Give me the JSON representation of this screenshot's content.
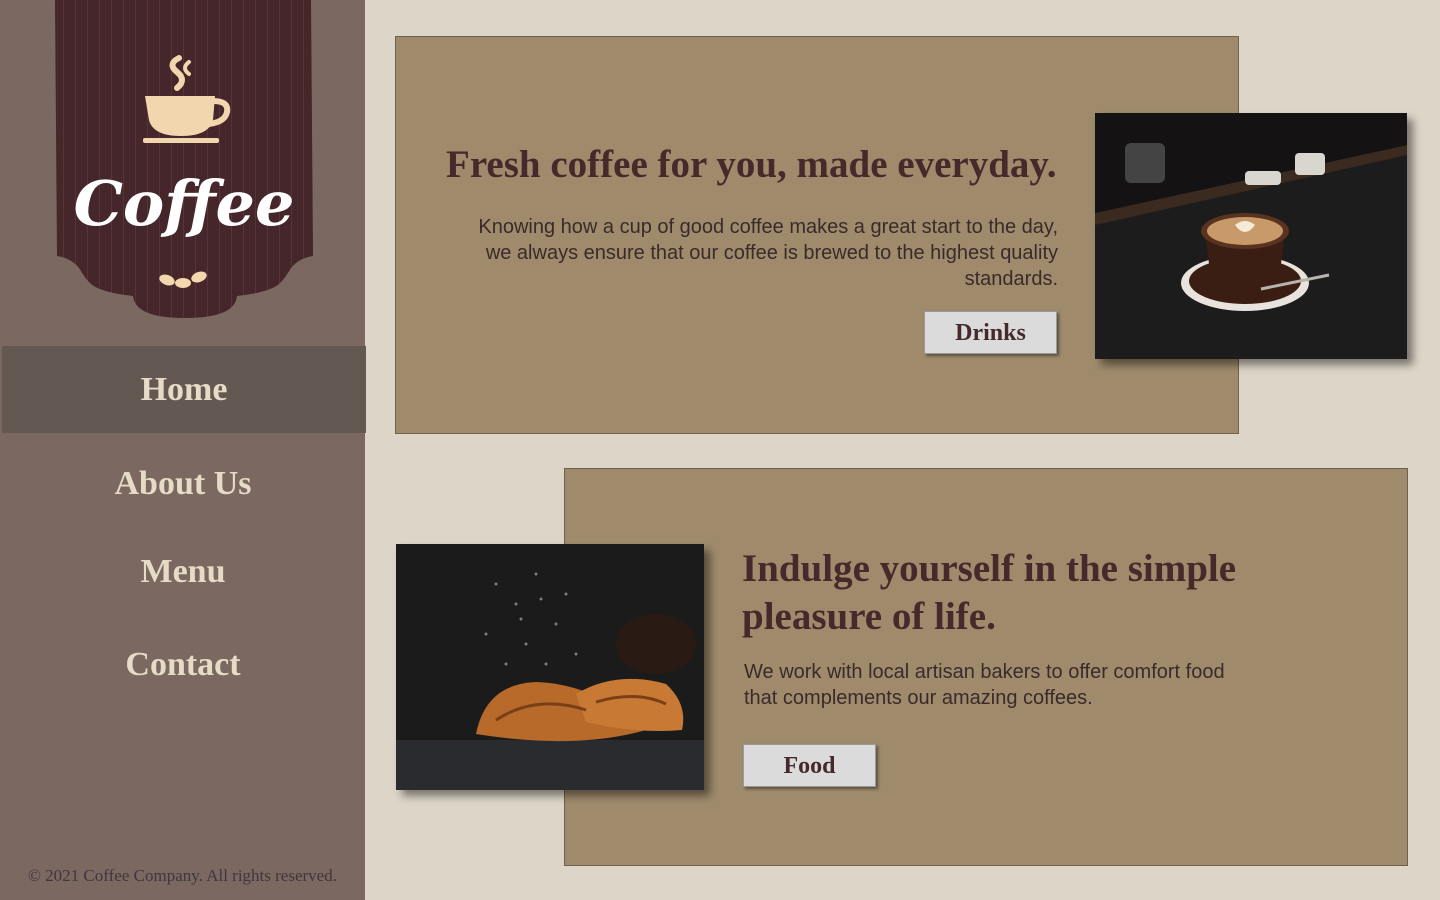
{
  "logo": {
    "text": "Coffee"
  },
  "nav": [
    {
      "label": "Home",
      "active": true
    },
    {
      "label": "About Us",
      "active": false
    },
    {
      "label": "Menu",
      "active": false
    },
    {
      "label": "Contact",
      "active": false
    }
  ],
  "footer": {
    "text": "© 2021 Coffee Company. All rights reserved."
  },
  "card1": {
    "title": "Fresh coffee for you, made everyday.",
    "text": "Knowing how a cup of good coffee makes a great start to the day, we always ensure that our coffee is brewed to the highest quality standards.",
    "button": "Drinks",
    "image": "latte-art-cup-photo"
  },
  "card2": {
    "title": "Indulge yourself in the simple pleasure of life.",
    "text": "We work with local artisan bakers to offer comfort food that complements our amazing coffees.",
    "button": "Food",
    "image": "croissants-photo"
  },
  "colors": {
    "sidebar": "#7b6860",
    "nav_active": "#645853",
    "background": "#ddd5c7",
    "card": "#9f8b6c",
    "heading": "#46292a",
    "logo_banner": "#45262a",
    "logo_cream": "#f1d6ae"
  }
}
